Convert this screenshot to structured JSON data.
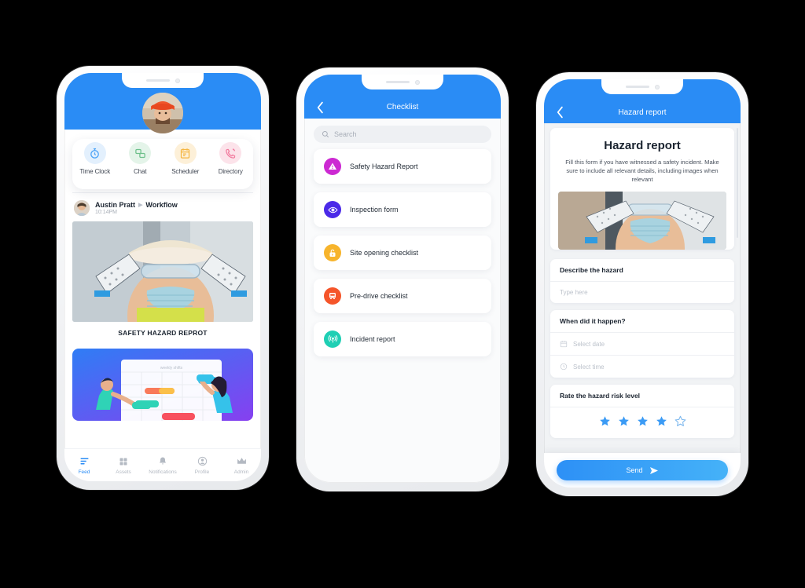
{
  "background_color": "#000000",
  "brand_blue": "#2a8cf5",
  "phones": [
    {
      "id": "phone-feed",
      "title": "Feed",
      "quick_actions": [
        {
          "label": "Time Clock",
          "icon": "stopwatch-icon",
          "color": "#4da3f7",
          "bg": "#e3f0fd"
        },
        {
          "label": "Chat",
          "icon": "chat-icon",
          "color": "#6ec08b",
          "bg": "#e4f4e9"
        },
        {
          "label": "Scheduler",
          "icon": "calendar-icon",
          "color": "#f5b642",
          "bg": "#fdf0d8"
        },
        {
          "label": "Directory",
          "icon": "phone-icon",
          "color": "#f27a9e",
          "bg": "#fce3ea"
        }
      ],
      "post": {
        "author": "Austin Pratt",
        "separator": "▶",
        "channel": "Workflow",
        "time": "10:14PM",
        "caption": "SAFETY HAZARD REPROT",
        "image_alt": "worker-goggles-mask-photo"
      },
      "post2": {
        "image_alt": "weekly-shifts-illustration",
        "board_title": "weekly shifts"
      },
      "bottom_nav": [
        {
          "label": "Feed",
          "icon": "feed-lines-icon",
          "active": true
        },
        {
          "label": "Assets",
          "icon": "grid-squares-icon",
          "active": false
        },
        {
          "label": "Notifications",
          "icon": "bell-icon",
          "active": false
        },
        {
          "label": "Profile",
          "icon": "person-circle-icon",
          "active": false
        },
        {
          "label": "Admin",
          "icon": "crown-icon",
          "active": false
        }
      ]
    },
    {
      "id": "phone-checklist",
      "header_title": "Checklist",
      "back_icon": "chevron-left-icon",
      "search_placeholder": "Search",
      "search_value": "",
      "items": [
        {
          "label": "Safety Hazard Report",
          "icon": "warning-triangle-icon",
          "color": "#cc29d2"
        },
        {
          "label": "Inspection form",
          "icon": "eye-icon",
          "color": "#4b2ae8"
        },
        {
          "label": "Site opening checklist",
          "icon": "padlock-open-icon",
          "color": "#f7b42c"
        },
        {
          "label": "Pre-drive checklist",
          "icon": "bus-icon",
          "color": "#f5552a"
        },
        {
          "label": "Incident report",
          "icon": "broadcast-icon",
          "color": "#1fcfb4"
        }
      ]
    },
    {
      "id": "phone-hazard-report",
      "header_title": "Hazard report",
      "back_icon": "chevron-left-icon",
      "form_title": "Hazard report",
      "form_description": "Fill this form if you have witnessed a safety incident. Make sure to include all relevant details, including images when relevant",
      "image_alt": "worker-goggles-mask-photo",
      "fields": [
        {
          "question": "Describe the  hazard",
          "inputs": [
            {
              "placeholder": "Type here",
              "icon": null,
              "value": ""
            }
          ]
        },
        {
          "question": "When did it happen?",
          "inputs": [
            {
              "placeholder": "Select date",
              "icon": "calendar-icon",
              "value": ""
            },
            {
              "placeholder": "Select time",
              "icon": "clock-icon",
              "value": ""
            }
          ]
        },
        {
          "question": "Rate the hazard risk level",
          "rating": {
            "value": 4,
            "max": 5,
            "icon": "star-icon",
            "color": "#3b9bf5"
          }
        }
      ],
      "send_label": "Send",
      "send_icon": "paper-plane-icon"
    }
  ]
}
